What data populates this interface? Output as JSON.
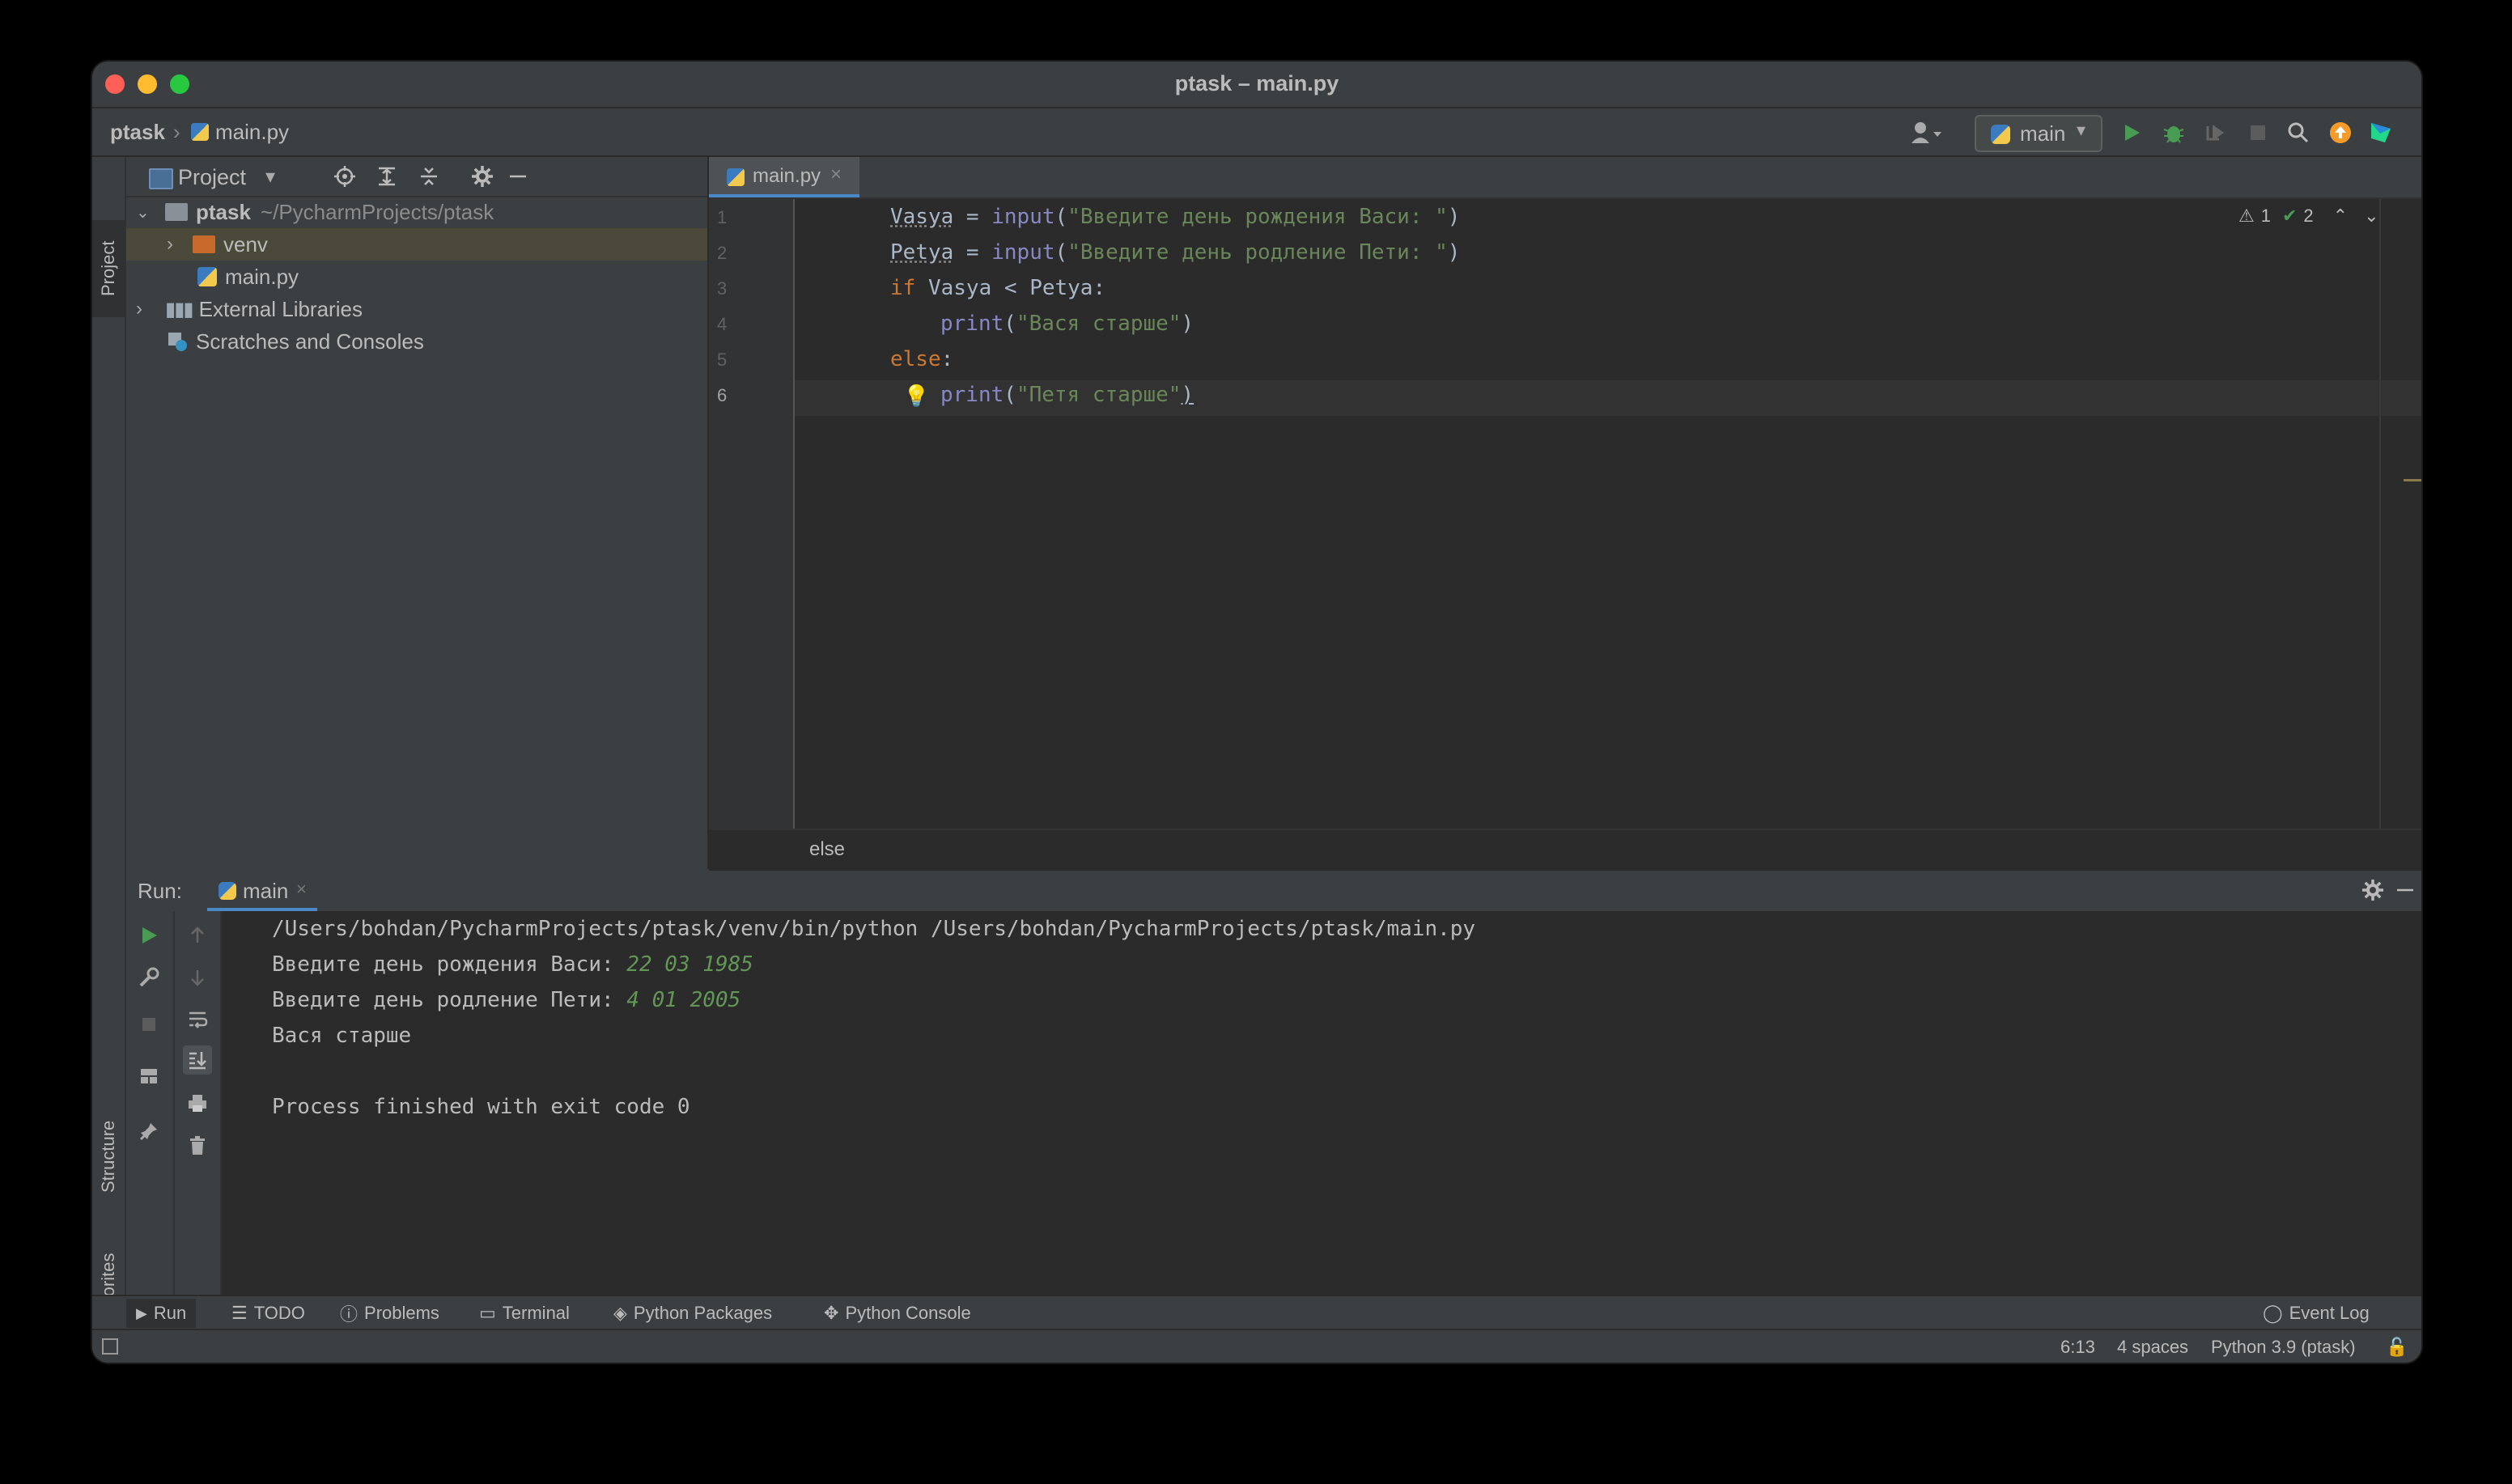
{
  "window": {
    "title": "ptask – main.py"
  },
  "navbar": {
    "project": "ptask",
    "file": "main.py",
    "run_config": "main"
  },
  "left_stripe": {
    "project_tab": "Project",
    "structure_tab": "Structure",
    "favorites_tab": "Favorites"
  },
  "project_panel": {
    "title": "Project",
    "tree": {
      "root_name": "ptask",
      "root_path": "~/PycharmProjects/ptask",
      "venv": "venv",
      "main_file": "main.py",
      "external_libraries": "External Libraries",
      "scratches": "Scratches and Consoles"
    }
  },
  "editor": {
    "tab_label": "main.py",
    "inspections": {
      "warnings": "1",
      "ok": "2"
    },
    "lines": [
      "1",
      "2",
      "3",
      "4",
      "5",
      "6"
    ],
    "code": {
      "l1_var": "Vasya",
      "l1_eq": " = ",
      "l1_fn": "input",
      "l1_open": "(",
      "l1_str": "\"Введите день рождения Васи: \"",
      "l1_close": ")",
      "l2_var": "Petya",
      "l2_eq": " = ",
      "l2_fn": "input",
      "l2_open": "(",
      "l2_str": "\"Введите день родление Пети: \"",
      "l2_close": ")",
      "l3_kw": "if",
      "l3_rest": " Vasya < Petya:",
      "l4_fn": "print",
      "l4_open": "(",
      "l4_str": "\"Вася старше\"",
      "l4_close": ")",
      "l5_kw": "else",
      "l5_rest": ":",
      "l6_fn": "print",
      "l6_open": "(",
      "l6_str": "\"Петя старше\"",
      "l6_close": ")"
    },
    "breadcrumb": "else"
  },
  "run_panel": {
    "label": "Run:",
    "tab": "main",
    "output": {
      "cmd": "/Users/bohdan/PycharmProjects/ptask/venv/bin/python /Users/bohdan/PycharmProjects/ptask/main.py",
      "prompt1": "Введите день рождения Васи: ",
      "input1": "22 03 1985",
      "prompt2": "Введите день родление Пети: ",
      "input2": "4 01 2005",
      "result": "Вася старше",
      "exit": "Process finished with exit code 0"
    }
  },
  "bottom_tabs": {
    "run": "Run",
    "todo": "TODO",
    "problems": "Problems",
    "terminal": "Terminal",
    "packages": "Python Packages",
    "console": "Python Console",
    "event_log": "Event Log"
  },
  "status": {
    "position": "6:13",
    "indent": "4 spaces",
    "interpreter": "Python 3.9 (ptask)"
  },
  "colors": {
    "keyword": "#cc7832",
    "string": "#6a8759",
    "builtin": "#8888c6",
    "run_green": "#499c54",
    "user_input": "#629755"
  }
}
